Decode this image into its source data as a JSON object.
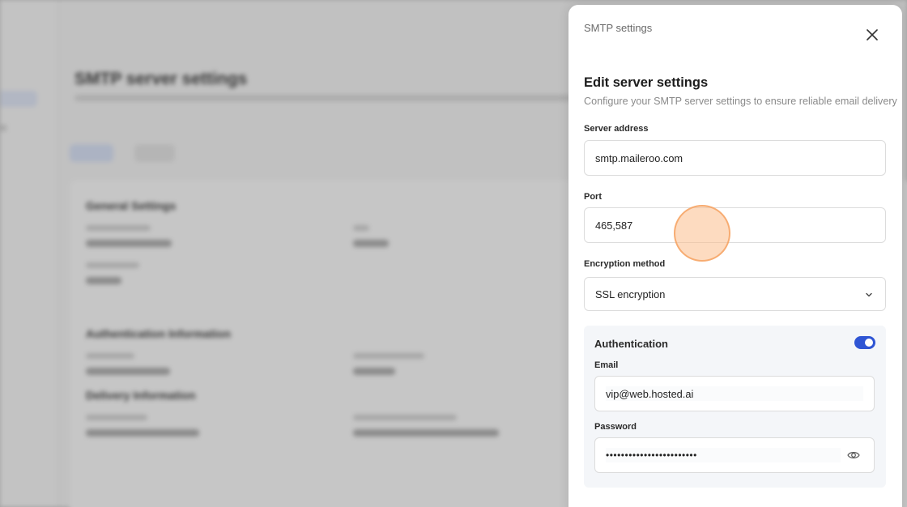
{
  "background": {
    "title": "SMTP server settings",
    "section1_title": "General Settings",
    "section2_title": "Authentication Information",
    "section3_title": "Delivery Information"
  },
  "modal": {
    "header_title": "SMTP settings",
    "close_icon": "close-icon",
    "heading": "Edit server settings",
    "description": "Configure your SMTP server settings to ensure reliable email delivery",
    "server_address": {
      "label": "Server address",
      "value": "smtp.maileroo.com"
    },
    "port": {
      "label": "Port",
      "value": "465,587"
    },
    "encryption": {
      "label": "Encryption method",
      "value": "SSL encryption",
      "icon": "chevron-down-icon"
    },
    "authentication": {
      "title": "Authentication",
      "enabled": true,
      "email": {
        "label": "Email",
        "value": "vip@web.hosted.ai"
      },
      "password": {
        "label": "Password",
        "value": "••••••••••••••••••••••••",
        "icon": "eye-icon"
      }
    }
  },
  "colors": {
    "accent": "#2f55d4",
    "cursor_highlight": "#f7b27c"
  }
}
